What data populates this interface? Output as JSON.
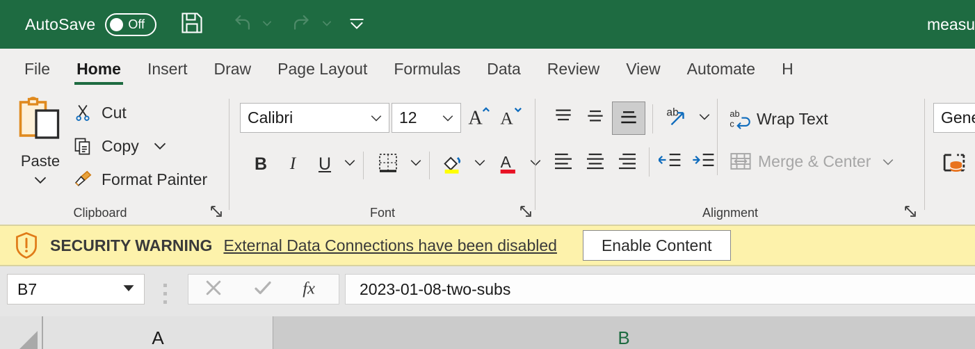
{
  "titlebar": {
    "autosave_label": "AutoSave",
    "autosave_state": "Off",
    "save_icon": "floppy-save-icon",
    "undo_icon": "undo-arrow-icon",
    "redo_icon": "redo-arrow-icon",
    "customize_qat_icon": "chevron-down-bar-icon",
    "document_title": "measu",
    "background_color": "#1e6b41"
  },
  "tabs": [
    {
      "label": "File",
      "active": false
    },
    {
      "label": "Home",
      "active": true
    },
    {
      "label": "Insert",
      "active": false
    },
    {
      "label": "Draw",
      "active": false
    },
    {
      "label": "Page Layout",
      "active": false
    },
    {
      "label": "Formulas",
      "active": false
    },
    {
      "label": "Data",
      "active": false
    },
    {
      "label": "Review",
      "active": false
    },
    {
      "label": "View",
      "active": false
    },
    {
      "label": "Automate",
      "active": false
    },
    {
      "label": "H",
      "active": false
    }
  ],
  "ribbon": {
    "clipboard": {
      "group_label": "Clipboard",
      "paste_label": "Paste",
      "paste_icon": "clipboard-paste-icon",
      "items": [
        {
          "label": "Cut",
          "icon": "scissors-icon",
          "has_caret": false
        },
        {
          "label": "Copy",
          "icon": "copy-pages-icon",
          "has_caret": true
        },
        {
          "label": "Format Painter",
          "icon": "paintbrush-icon",
          "has_caret": false
        }
      ],
      "launcher_icon": "dialog-launcher-icon"
    },
    "font": {
      "group_label": "Font",
      "font_name": "Calibri",
      "font_size": "12",
      "grow_font_icon": "grow-font-icon",
      "shrink_font_icon": "shrink-font-icon",
      "bold_label": "B",
      "italic_label": "I",
      "underline_label": "U",
      "borders_icon": "borders-icon",
      "fill_color_icon": "fill-color-icon",
      "font_color_icon": "font-color-icon",
      "fill_color": "#ffff00",
      "font_color": "#e81123",
      "launcher_icon": "dialog-launcher-icon"
    },
    "alignment": {
      "group_label": "Alignment",
      "top_align_icon": "align-top-icon",
      "middle_align_icon": "align-middle-icon",
      "bottom_align_icon": "align-bottom-icon",
      "bottom_align_active": true,
      "orientation_icon": "text-orientation-icon",
      "wrap_text_label": "Wrap Text",
      "wrap_text_icon": "wrap-text-icon",
      "align_left_icon": "align-left-icon",
      "align_center_icon": "align-center-icon",
      "align_right_icon": "align-right-icon",
      "decrease_indent_icon": "decrease-indent-icon",
      "increase_indent_icon": "increase-indent-icon",
      "merge_center_label": "Merge & Center",
      "merge_center_icon": "merge-cells-icon",
      "merge_center_disabled": true,
      "launcher_icon": "dialog-launcher-icon"
    },
    "number": {
      "format_value": "Gener",
      "data_type_icon": "data-type-icon"
    }
  },
  "security_bar": {
    "icon": "shield-warning-icon",
    "title": "SECURITY WARNING",
    "message": "External Data Connections have been disabled",
    "button_label": "Enable Content",
    "background_color": "#fdf2ab"
  },
  "formula_bar": {
    "name_box_value": "B7",
    "name_box_caret_icon": "chevron-down-icon",
    "cancel_icon": "cancel-x-icon",
    "confirm_icon": "confirm-check-icon",
    "insert_function_icon": "fx-icon",
    "formula_value": "2023-01-08-two-subs"
  },
  "grid": {
    "select_all_icon": "select-all-corner-icon",
    "columns": [
      {
        "label": "A",
        "selected": false
      },
      {
        "label": "B",
        "selected": true
      }
    ]
  }
}
